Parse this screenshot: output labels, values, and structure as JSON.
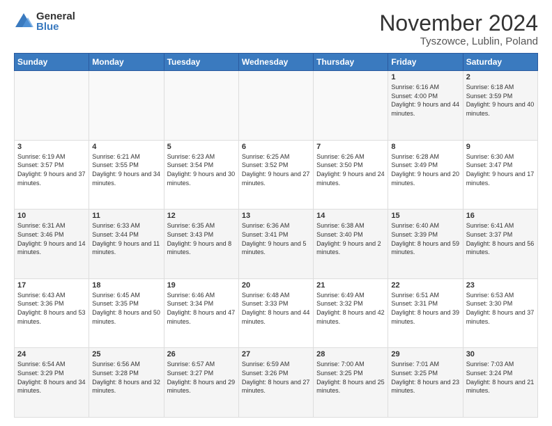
{
  "header": {
    "logo_general": "General",
    "logo_blue": "Blue",
    "title": "November 2024",
    "subtitle": "Tyszowce, Lublin, Poland"
  },
  "calendar": {
    "days_of_week": [
      "Sunday",
      "Monday",
      "Tuesday",
      "Wednesday",
      "Thursday",
      "Friday",
      "Saturday"
    ],
    "weeks": [
      [
        {
          "day": "",
          "info": ""
        },
        {
          "day": "",
          "info": ""
        },
        {
          "day": "",
          "info": ""
        },
        {
          "day": "",
          "info": ""
        },
        {
          "day": "",
          "info": ""
        },
        {
          "day": "1",
          "info": "Sunrise: 6:16 AM\nSunset: 4:00 PM\nDaylight: 9 hours and 44 minutes."
        },
        {
          "day": "2",
          "info": "Sunrise: 6:18 AM\nSunset: 3:59 PM\nDaylight: 9 hours and 40 minutes."
        }
      ],
      [
        {
          "day": "3",
          "info": "Sunrise: 6:19 AM\nSunset: 3:57 PM\nDaylight: 9 hours and 37 minutes."
        },
        {
          "day": "4",
          "info": "Sunrise: 6:21 AM\nSunset: 3:55 PM\nDaylight: 9 hours and 34 minutes."
        },
        {
          "day": "5",
          "info": "Sunrise: 6:23 AM\nSunset: 3:54 PM\nDaylight: 9 hours and 30 minutes."
        },
        {
          "day": "6",
          "info": "Sunrise: 6:25 AM\nSunset: 3:52 PM\nDaylight: 9 hours and 27 minutes."
        },
        {
          "day": "7",
          "info": "Sunrise: 6:26 AM\nSunset: 3:50 PM\nDaylight: 9 hours and 24 minutes."
        },
        {
          "day": "8",
          "info": "Sunrise: 6:28 AM\nSunset: 3:49 PM\nDaylight: 9 hours and 20 minutes."
        },
        {
          "day": "9",
          "info": "Sunrise: 6:30 AM\nSunset: 3:47 PM\nDaylight: 9 hours and 17 minutes."
        }
      ],
      [
        {
          "day": "10",
          "info": "Sunrise: 6:31 AM\nSunset: 3:46 PM\nDaylight: 9 hours and 14 minutes."
        },
        {
          "day": "11",
          "info": "Sunrise: 6:33 AM\nSunset: 3:44 PM\nDaylight: 9 hours and 11 minutes."
        },
        {
          "day": "12",
          "info": "Sunrise: 6:35 AM\nSunset: 3:43 PM\nDaylight: 9 hours and 8 minutes."
        },
        {
          "day": "13",
          "info": "Sunrise: 6:36 AM\nSunset: 3:41 PM\nDaylight: 9 hours and 5 minutes."
        },
        {
          "day": "14",
          "info": "Sunrise: 6:38 AM\nSunset: 3:40 PM\nDaylight: 9 hours and 2 minutes."
        },
        {
          "day": "15",
          "info": "Sunrise: 6:40 AM\nSunset: 3:39 PM\nDaylight: 8 hours and 59 minutes."
        },
        {
          "day": "16",
          "info": "Sunrise: 6:41 AM\nSunset: 3:37 PM\nDaylight: 8 hours and 56 minutes."
        }
      ],
      [
        {
          "day": "17",
          "info": "Sunrise: 6:43 AM\nSunset: 3:36 PM\nDaylight: 8 hours and 53 minutes."
        },
        {
          "day": "18",
          "info": "Sunrise: 6:45 AM\nSunset: 3:35 PM\nDaylight: 8 hours and 50 minutes."
        },
        {
          "day": "19",
          "info": "Sunrise: 6:46 AM\nSunset: 3:34 PM\nDaylight: 8 hours and 47 minutes."
        },
        {
          "day": "20",
          "info": "Sunrise: 6:48 AM\nSunset: 3:33 PM\nDaylight: 8 hours and 44 minutes."
        },
        {
          "day": "21",
          "info": "Sunrise: 6:49 AM\nSunset: 3:32 PM\nDaylight: 8 hours and 42 minutes."
        },
        {
          "day": "22",
          "info": "Sunrise: 6:51 AM\nSunset: 3:31 PM\nDaylight: 8 hours and 39 minutes."
        },
        {
          "day": "23",
          "info": "Sunrise: 6:53 AM\nSunset: 3:30 PM\nDaylight: 8 hours and 37 minutes."
        }
      ],
      [
        {
          "day": "24",
          "info": "Sunrise: 6:54 AM\nSunset: 3:29 PM\nDaylight: 8 hours and 34 minutes."
        },
        {
          "day": "25",
          "info": "Sunrise: 6:56 AM\nSunset: 3:28 PM\nDaylight: 8 hours and 32 minutes."
        },
        {
          "day": "26",
          "info": "Sunrise: 6:57 AM\nSunset: 3:27 PM\nDaylight: 8 hours and 29 minutes."
        },
        {
          "day": "27",
          "info": "Sunrise: 6:59 AM\nSunset: 3:26 PM\nDaylight: 8 hours and 27 minutes."
        },
        {
          "day": "28",
          "info": "Sunrise: 7:00 AM\nSunset: 3:25 PM\nDaylight: 8 hours and 25 minutes."
        },
        {
          "day": "29",
          "info": "Sunrise: 7:01 AM\nSunset: 3:25 PM\nDaylight: 8 hours and 23 minutes."
        },
        {
          "day": "30",
          "info": "Sunrise: 7:03 AM\nSunset: 3:24 PM\nDaylight: 8 hours and 21 minutes."
        }
      ]
    ]
  }
}
